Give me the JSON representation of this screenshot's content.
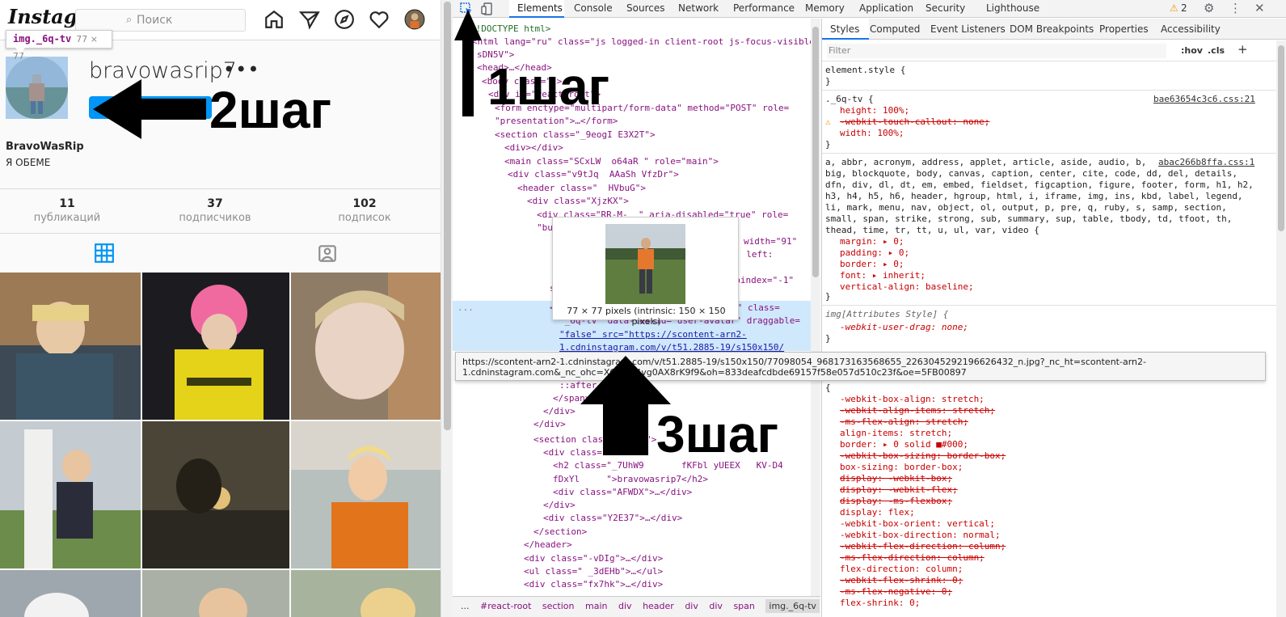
{
  "instagram": {
    "logo": "Instagram",
    "search_placeholder": "Поиск",
    "tooltip": {
      "tag": "img._6q-tv",
      "size": "77 × 77"
    },
    "username": "bravowasrip7",
    "more": "•••",
    "full_name": "BravoWasRip",
    "bio": "Я ОБЕМЕ",
    "stats": [
      {
        "count": "11",
        "label": "публикаций"
      },
      {
        "count": "37",
        "label": "подписчиков"
      },
      {
        "count": "102",
        "label": "подписок"
      }
    ],
    "nav_icons": [
      "home-icon",
      "direct-icon",
      "explore-icon",
      "activity-heart-icon",
      "profile-avatar-icon"
    ],
    "tab_icons": [
      "grid-icon",
      "tagged-icon"
    ],
    "photo_colors": [
      "#8a6b4e",
      "#e5d23a",
      "#9a8f7d",
      "#c7b48a",
      "#3a3a36",
      "#c9a76a",
      "#7a8a88",
      "#b0b8bd",
      "#a6a38c"
    ]
  },
  "devtools": {
    "tabs": [
      "Elements",
      "Console",
      "Sources",
      "Network",
      "Performance",
      "Memory",
      "Application",
      "Security",
      "Lighthouse"
    ],
    "warning_count": "2",
    "dom_lines": [
      {
        "t": "<!DOCTYPE html>"
      },
      {
        "t": "<html lang=\"ru\" class=\"js logged-in client-root js-focus-visible"
      },
      {
        "t": "sDN5V\">"
      },
      {
        "t": "<head>…</head>"
      },
      {
        "t": "<body class=\"\">"
      },
      {
        "t": "<div id=\"react-root\">"
      },
      {
        "t": "<form enctype=\"multipart/form-data\" method=\"POST\" role="
      },
      {
        "t": "\"presentation\">…</form>"
      },
      {
        "t": "<section class=\"_9eogI E3X2T\">"
      },
      {
        "t": "<div></div>"
      },
      {
        "t": "<main class=\"SCxLW  o64aR \" role=\"main\">"
      },
      {
        "t": "<div class=\"v9tJq  AAaSh VfzDr\">"
      },
      {
        "t": "<header class=\"  HVbuG\">"
      },
      {
        "t": "<div class=\"XjzKX\">"
      },
      {
        "t": "<div class=\"RR-M-  \" aria-disabled=\"true\" role="
      },
      {
        "t": "\"button\" tabindex=\"-1\">"
      },
      {
        "t": "width=\"91\""
      },
      {
        "t": "; left:"
      },
      {
        "t": "tabindex=\"-1\""
      },
      {
        "t": "sty"
      },
      {
        "t": "<img alt=\"Фото профиля bravowasrip7\" class="
      },
      {
        "t": "\"_6q-tv\" data-testid=\"user-avatar\" draggable="
      },
      {
        "t": "\"false\" src=\"https://scontent-arn2-"
      },
      {
        "t": "1.cdninstagram.com/v/t51.2885-19/s150x150/"
      },
      {
        "t": "::after"
      },
      {
        "t": "</span>"
      },
      {
        "t": "</div>"
      },
      {
        "t": "</div>"
      },
      {
        "t": "<section class=\"zwlfE\">"
      },
      {
        "t": "<div class=\"nZSzR\">"
      },
      {
        "t": "<h2 class=\"_7UhW9       fKFbl yUEEX   KV-D4"
      },
      {
        "t": "fDxYl     \">bravowasrip7</h2>"
      },
      {
        "t": "<div class=\"AFWDX\">…</div>"
      },
      {
        "t": "</div>"
      },
      {
        "t": "<div class=\"Y2E37\">…</div>"
      },
      {
        "t": "</section>"
      },
      {
        "t": "</header>"
      },
      {
        "t": "<div class=\"-vDIg\">…</div>"
      },
      {
        "t": "<ul class=\" _3dEHb\">…</ul>"
      },
      {
        "t": "<div class=\"fx7hk\">…</div>"
      }
    ],
    "ellipsis": "...",
    "breadcrumbs": [
      "#react-root",
      "section",
      "main",
      "div",
      "header",
      "div",
      "div",
      "span",
      "img._6q-tv"
    ],
    "styles_tabs": [
      "Styles",
      "Computed",
      "Event Listeners",
      "DOM Breakpoints",
      "Properties",
      "Accessibility"
    ],
    "filter_placeholder": "Filter",
    "hov": ":hov",
    "cls": ".cls",
    "plus": "+",
    "rules": {
      "element_style": "element.style {",
      "close": "}",
      "r1_sel": "._6q-tv {",
      "r1_src": "bae63654c3c6.css:21",
      "r1_p1": "height: 100%;",
      "r1_p2": "-webkit-touch-callout: none;",
      "r1_p3": "width: 100%;",
      "r2_sel_lines": [
        "a, abbr, acronym, address, applet, article, aside, audio, b,",
        "big, blockquote, body, canvas, caption, center, cite, code, dd, del, details,",
        "dfn, div, dl, dt, em, embed, fieldset, figcaption, figure, footer, form, h1, h2,",
        "h3, h4, h5, h6, header, hgroup, html, i, iframe, img, ins, kbd, label, legend,",
        "li, mark, menu, nav, object, ol, output, p, pre, q, ruby, s, samp, section,",
        "small, span, strike, strong, sub, summary, sup, table, tbody, td, tfoot, th,",
        "thead, time, tr, tt, u, ul, var, video {"
      ],
      "r2_src": "abac266b8ffa.css:1",
      "r2_props": [
        "margin: ▸ 0;",
        "padding: ▸ 0;",
        "border: ▸ 0;",
        "font: ▸ inherit;",
        "vertical-align: baseline;"
      ],
      "r3_sel": "img[Attributes Style] {",
      "r3_p1": "-webkit-user-drag: none;",
      "r4_open": "{",
      "r4_props": [
        {
          "t": "-webkit-box-align: stretch;",
          "s": false
        },
        {
          "t": "-webkit-align-items: stretch;",
          "s": true
        },
        {
          "t": "-ms-flex-align: stretch;",
          "s": true
        },
        {
          "t": "align-items: stretch;",
          "s": false
        },
        {
          "t": "border: ▸ 0 solid ■#000;",
          "s": false
        },
        {
          "t": "-webkit-box-sizing: border-box;",
          "s": true
        },
        {
          "t": "box-sizing: border-box;",
          "s": false
        },
        {
          "t": "display: -webkit-box;",
          "s": true
        },
        {
          "t": "display: -webkit-flex;",
          "s": true
        },
        {
          "t": "display: -ms-flexbox;",
          "s": true
        },
        {
          "t": "display: flex;",
          "s": false
        },
        {
          "t": "-webkit-box-orient: vertical;",
          "s": false
        },
        {
          "t": "-webkit-box-direction: normal;",
          "s": false
        },
        {
          "t": "-webkit-flex-direction: column;",
          "s": true
        },
        {
          "t": "-ms-flex-direction: column;",
          "s": true
        },
        {
          "t": "flex-direction: column;",
          "s": false
        },
        {
          "t": "-webkit-flex-shrink: 0;",
          "s": true
        },
        {
          "t": "-ms-flex-negative: 0;",
          "s": true
        },
        {
          "t": "flex-shrink: 0;",
          "s": false
        }
      ]
    },
    "img_popup_caption": "77 × 77 pixels (intrinsic: 150 × 150 pixels)",
    "url_popup": [
      "https://scontent-arn2-1.cdninstagram.com/v/t51.2885-19/s150x150/77098054_968173163568655_2263045292196626432_n.jpg?_nc_ht=scontent-arn2-",
      "1.cdninstagram.com&_nc_ohc=XQRZU4vg0AX8rK9f9&oh=833deafcdbde69157f58e057d510c23f&oe=5FB00897"
    ]
  },
  "annotations": {
    "step1": "1шаг",
    "step2": "2шаг",
    "step3": "3шаг"
  }
}
